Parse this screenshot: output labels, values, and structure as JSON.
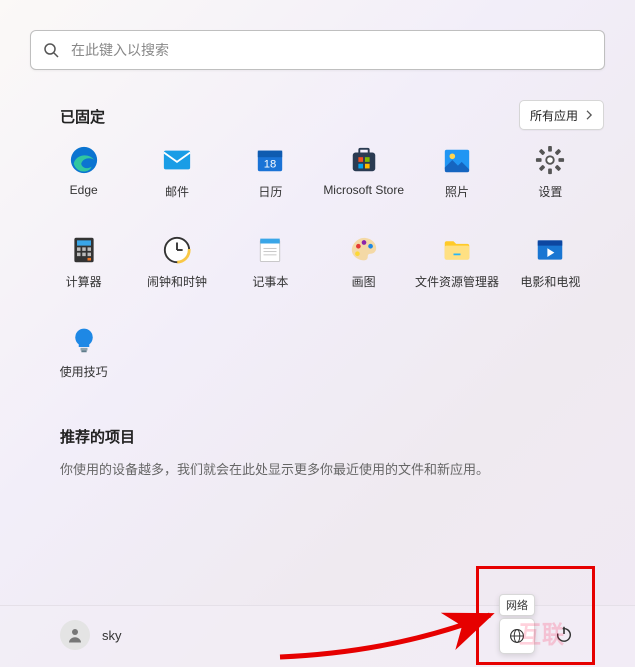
{
  "search": {
    "placeholder": "在此键入以搜索"
  },
  "pinned": {
    "title": "已固定",
    "all_apps": "所有应用",
    "items": [
      {
        "label": "Edge",
        "icon": "edge"
      },
      {
        "label": "邮件",
        "icon": "mail"
      },
      {
        "label": "日历",
        "icon": "calendar"
      },
      {
        "label": "Microsoft Store",
        "icon": "store"
      },
      {
        "label": "照片",
        "icon": "photos"
      },
      {
        "label": "设置",
        "icon": "settings"
      },
      {
        "label": "计算器",
        "icon": "calc"
      },
      {
        "label": "闹钟和时钟",
        "icon": "clock"
      },
      {
        "label": "记事本",
        "icon": "notepad"
      },
      {
        "label": "画图",
        "icon": "paint"
      },
      {
        "label": "文件资源管理器",
        "icon": "explorer"
      },
      {
        "label": "电影和电视",
        "icon": "movies"
      },
      {
        "label": "使用技巧",
        "icon": "tips"
      }
    ]
  },
  "recommended": {
    "title": "推荐的项目",
    "text": "你使用的设备越多，我们就会在此处显示更多你最近使用的文件和新应用。"
  },
  "user": {
    "name": "sky"
  },
  "tooltip": {
    "network": "网络"
  },
  "watermark": "互联"
}
